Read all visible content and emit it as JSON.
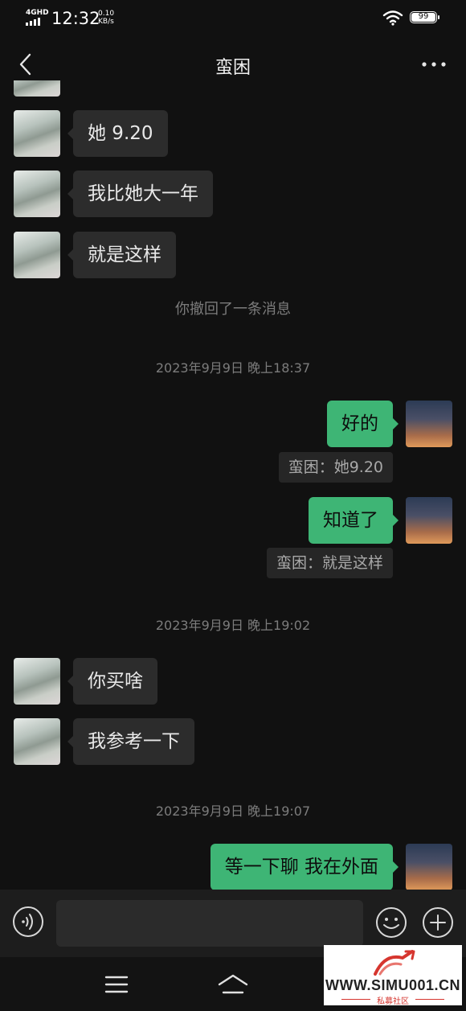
{
  "status_bar": {
    "network": "4GHD",
    "time": "12:32",
    "speed_value": "0.10",
    "speed_unit": "KB/s",
    "battery": "99"
  },
  "header": {
    "title": "蛮困",
    "back_icon": "chevron-left-icon",
    "more_icon": "more-dots-icon"
  },
  "messages": {
    "m1": "她 9.20",
    "m2": "我比她大一年",
    "m3": "就是这样",
    "recall_notice": "你撤回了一条消息",
    "time1": "2023年9月9日 晚上18:37",
    "m4": "好的",
    "q4": "蛮困：她9.20",
    "m5": "知道了",
    "q5": "蛮困：就是这样",
    "time2": "2023年9月9日 晚上19:02",
    "m6": "你买啥",
    "m7": "我参考一下",
    "time3": "2023年9月9日 晚上19:07",
    "m8": "等一下聊  我在外面"
  },
  "input_bar": {
    "voice_icon": "voice-icon",
    "emoji_icon": "emoji-icon",
    "plus_icon": "plus-icon",
    "text_value": ""
  },
  "nav": {
    "menu_icon": "menu-icon",
    "home_icon": "home-icon"
  },
  "watermark": {
    "text": "WWW.SIMU001.CN",
    "subtext": "私募社区"
  },
  "colors": {
    "background": "#111111",
    "incoming_bubble": "#2c2c2c",
    "outgoing_bubble": "#3eb575"
  }
}
